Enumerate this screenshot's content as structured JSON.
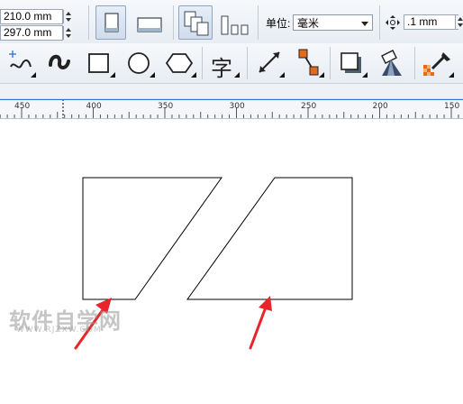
{
  "property_bar": {
    "width_value": "210.0 mm",
    "height_value": "297.0 mm",
    "units_label": "单位:",
    "units_value": "毫米",
    "nudge_value": ".1 mm"
  },
  "toolbox": {
    "text_tool_glyph": "字"
  },
  "ruler": {
    "ticks": [
      "450",
      "400",
      "350",
      "300",
      "250",
      "200",
      "150"
    ]
  },
  "watermark": {
    "title": "软件自学网",
    "url": "WWW.RJZXW.COM"
  },
  "colors": {
    "accent_blue": "#2f6fd8",
    "arrow_red": "#e8252a",
    "shape_stroke": "#000000"
  }
}
